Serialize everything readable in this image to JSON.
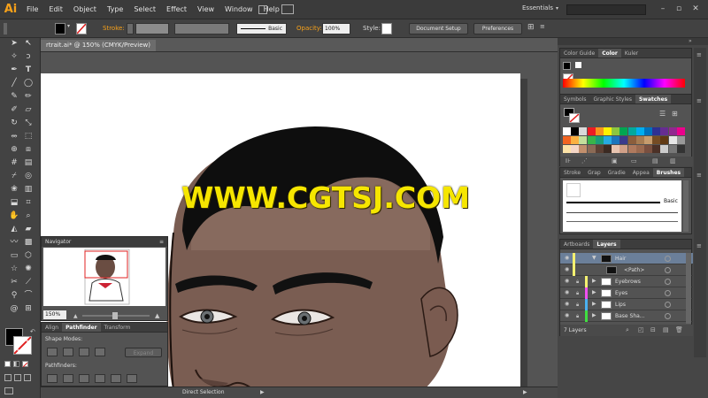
{
  "menubar": {
    "logo": "Ai",
    "items": [
      "File",
      "Edit",
      "Object",
      "Type",
      "Select",
      "Effect",
      "View",
      "Window",
      "Help"
    ],
    "workspace": "Essentials"
  },
  "controlbar": {
    "stroke_label": "Stroke:",
    "brush_value": "Basic",
    "opacity_label": "Opacity:",
    "opacity_value": "100%",
    "style_label": "Style:",
    "document_setup": "Document Setup",
    "preferences": "Preferences"
  },
  "document": {
    "tab_title": "rtrait.ai* @ 150% (CMYK/Preview)"
  },
  "navigator": {
    "title": "Navigator",
    "zoom": "150%"
  },
  "pathfinder": {
    "tabs": [
      "Align",
      "Pathfinder",
      "Transform"
    ],
    "shape_modes_label": "Shape Modes:",
    "pathfinders_label": "Pathfinders:",
    "expand_label": "Expand"
  },
  "statusbar": {
    "tool_name": "Direct Selection"
  },
  "color_panel": {
    "tabs": [
      "Color Guide",
      "Color",
      "Kuler"
    ]
  },
  "swatches_panel": {
    "tabs": [
      "Symbols",
      "Graphic Styles",
      "Swatches"
    ]
  },
  "brushes_panel": {
    "tabs": [
      "Stroke",
      "Grap",
      "Gradie",
      "Appea",
      "Brushes"
    ],
    "brush_name": "Basic"
  },
  "layers_panel": {
    "tabs": [
      "Artboards",
      "Layers"
    ],
    "layers": [
      {
        "name": "Hair",
        "color": "#f3f070",
        "selected": true,
        "expanded": true
      },
      {
        "name": "<Path>",
        "color": "#f3f070",
        "selected": false,
        "sublayer": true
      },
      {
        "name": "Eyebrows",
        "color": "#f3f070",
        "selected": false
      },
      {
        "name": "Eyes",
        "color": "#f050f0",
        "selected": false
      },
      {
        "name": "Lips",
        "color": "#4ab0f0",
        "selected": false
      },
      {
        "name": "Base Sha...",
        "color": "#40e040",
        "selected": false
      }
    ],
    "layer_count": "7 Layers"
  },
  "watermark": "WWW.CGTSJ.COM",
  "colors": {
    "accent": "#f7a11a",
    "watermark": "#f6e600",
    "selection": "#6b7f99",
    "skin": "#7b5e52",
    "hair": "#0e0e0e"
  }
}
